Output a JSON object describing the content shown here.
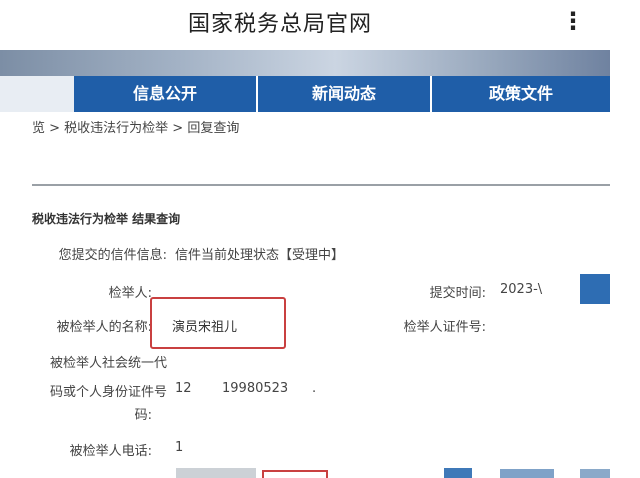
{
  "app": {
    "title": "国家税务总局官网",
    "menu_icon": "kebab-menu-icon"
  },
  "nav": {
    "items": [
      "信息公开",
      "新闻动态",
      "政策文件"
    ]
  },
  "breadcrumb": "览 > 税收违法行为检举 > 回复查询",
  "section_title": "税收违法行为检举 结果查询",
  "fields": {
    "letter_info_label": "您提交的信件信息:",
    "letter_info_value": "信件当前处理状态【受理中】",
    "reporter_label": "检举人:",
    "submit_time_label": "提交时间:",
    "submit_time_value": "2023-\\",
    "reported_name_label": "被检举人的名称:",
    "reported_name_value": "演员宋祖儿",
    "reporter_id_label": "检举人证件号:",
    "credit_code_label_1": "被检举人社会统一代",
    "credit_code_label_2": "码或个人身份证件号",
    "credit_code_label_3": "码:",
    "credit_code_value_a": "12",
    "credit_code_value_b": "19980523",
    "credit_code_value_c": ".",
    "phone_label": "被检举人电话:",
    "phone_value": "1"
  },
  "colors": {
    "nav_blue": "#1f5ea8",
    "highlight_red": "#c94040"
  }
}
